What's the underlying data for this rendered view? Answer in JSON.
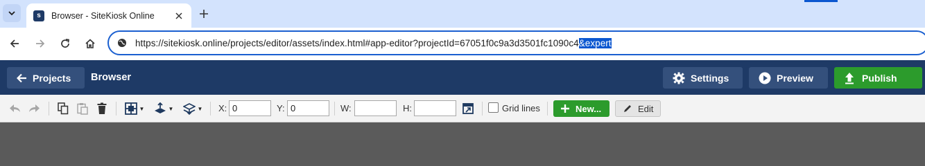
{
  "browser": {
    "tab_title": "Browser - SiteKiosk Online",
    "favicon_text": "s",
    "url_plain": "https://sitekiosk.online/projects/editor/assets/index.html#app-editor?projectId=67051f0c9a3d3501fc1090c4",
    "url_selected": "&expert"
  },
  "header": {
    "back_label": "Projects",
    "title": "Browser",
    "settings_label": "Settings",
    "preview_label": "Preview",
    "publish_label": "Publish"
  },
  "toolbar": {
    "x_label": "X:",
    "x_value": "0",
    "y_label": "Y:",
    "y_value": "0",
    "w_label": "W:",
    "w_value": "",
    "h_label": "H:",
    "h_value": "",
    "gridlines_label": "Grid lines",
    "new_label": "New...",
    "edit_label": "Edit"
  },
  "colors": {
    "header_bg": "#1e3a66",
    "accent_green": "#2c9b2c",
    "tabstrip_bg": "#d3e3fd",
    "omnibox_border": "#1a5fd0"
  }
}
